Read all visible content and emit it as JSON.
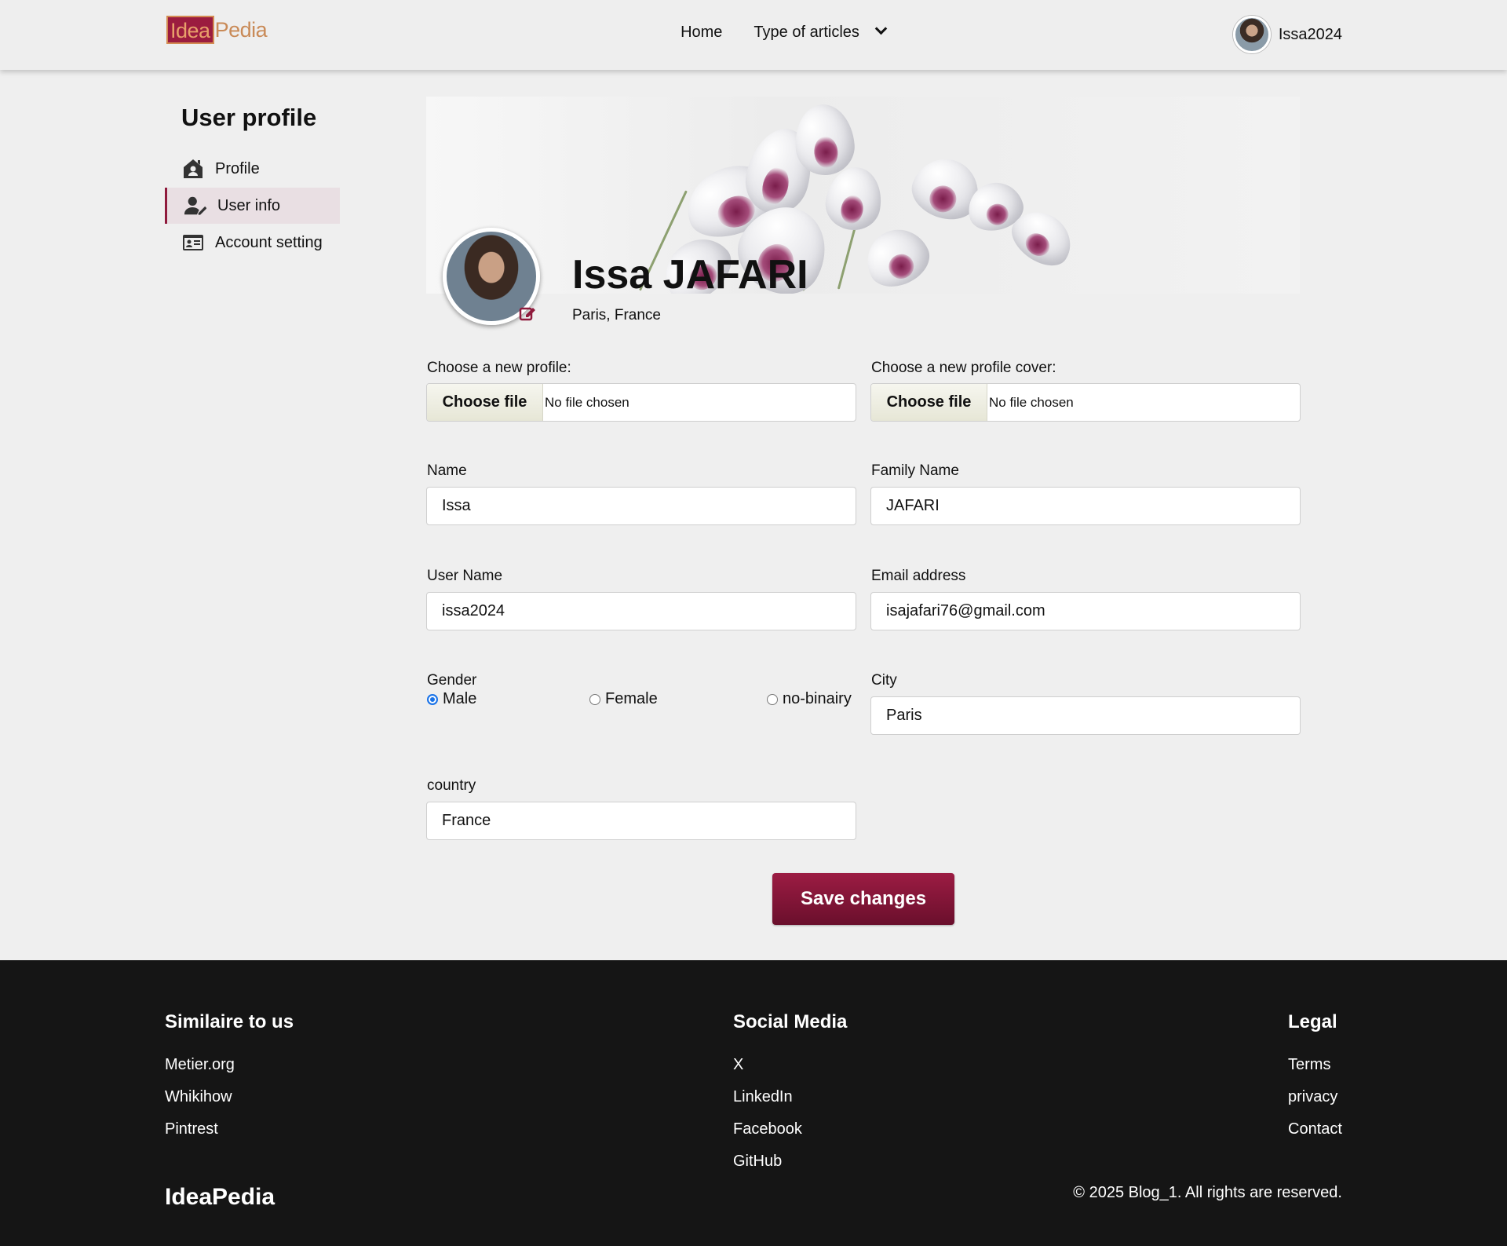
{
  "header": {
    "logo_part1": "Idea",
    "logo_part2": "Pedia",
    "nav": {
      "home": "Home",
      "articles": "Type of articles"
    },
    "username": "Issa2024"
  },
  "sidebar": {
    "title": "User profile",
    "items": [
      {
        "label": "Profile",
        "icon": "home-user-icon",
        "active": false
      },
      {
        "label": "User info",
        "icon": "user-edit-icon",
        "active": true
      },
      {
        "label": "Account setting",
        "icon": "id-card-icon",
        "active": false
      }
    ]
  },
  "profile": {
    "name": "Issa JAFARI",
    "location": "Paris, France"
  },
  "form": {
    "profile_file_label": "Choose a new profile:",
    "cover_file_label": "Choose a new profile cover:",
    "file_button": "Choose file",
    "file_status": "No file chosen",
    "name_label": "Name",
    "name_value": "Issa",
    "family_label": "Family Name",
    "family_value": "JAFARI",
    "username_label": "User Name",
    "username_value": "issa2024",
    "email_label": "Email address",
    "email_value": "isajafari76@gmail.com",
    "gender_label": "Gender",
    "gender_options": [
      "Male",
      "Female",
      "no-binairy"
    ],
    "gender_selected": "Male",
    "city_label": "City",
    "city_value": "Paris",
    "country_label": "country",
    "country_value": "France",
    "save_label": "Save changes"
  },
  "colors": {
    "accent": "#8f1a3c",
    "footer_bg": "#151515",
    "page_bg": "#efefef"
  },
  "footer": {
    "col1": {
      "title": "Similaire to us",
      "links": [
        "Metier.org",
        "Whikihow",
        "Pintrest"
      ]
    },
    "col2": {
      "title": "Social Media",
      "links": [
        "X",
        "LinkedIn",
        "Facebook",
        "GitHub"
      ]
    },
    "col3": {
      "title": "Legal",
      "links": [
        "Terms",
        "privacy",
        "Contact"
      ]
    },
    "brand": "IdeaPedia",
    "copyright": "© 2025 Blog_1. All rights are reserved."
  }
}
